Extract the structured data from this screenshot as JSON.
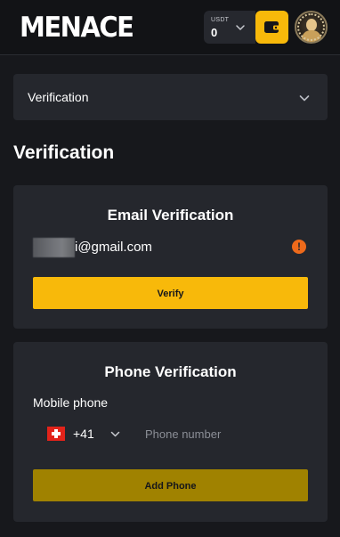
{
  "header": {
    "logo": "MENACE",
    "balance": {
      "currency": "USDT",
      "amount": "0"
    },
    "icons": {
      "wallet": "wallet-icon",
      "chevron": "chevron-down-icon",
      "avatar": "user-avatar"
    },
    "colors": {
      "accent": "#f8b90a",
      "background": "#121316"
    }
  },
  "dropdown": {
    "label": "Verification"
  },
  "page_title": "Verification",
  "email_card": {
    "title": "Email Verification",
    "email_visible": "i@gmail.com",
    "warning_icon": "exclamation-icon",
    "verify_label": "Verify"
  },
  "phone_card": {
    "title": "Phone Verification",
    "mobile_label": "Mobile phone",
    "country_flag": "switzerland-flag",
    "dial_code": "+41",
    "phone_placeholder": "Phone number",
    "add_label": "Add Phone"
  }
}
